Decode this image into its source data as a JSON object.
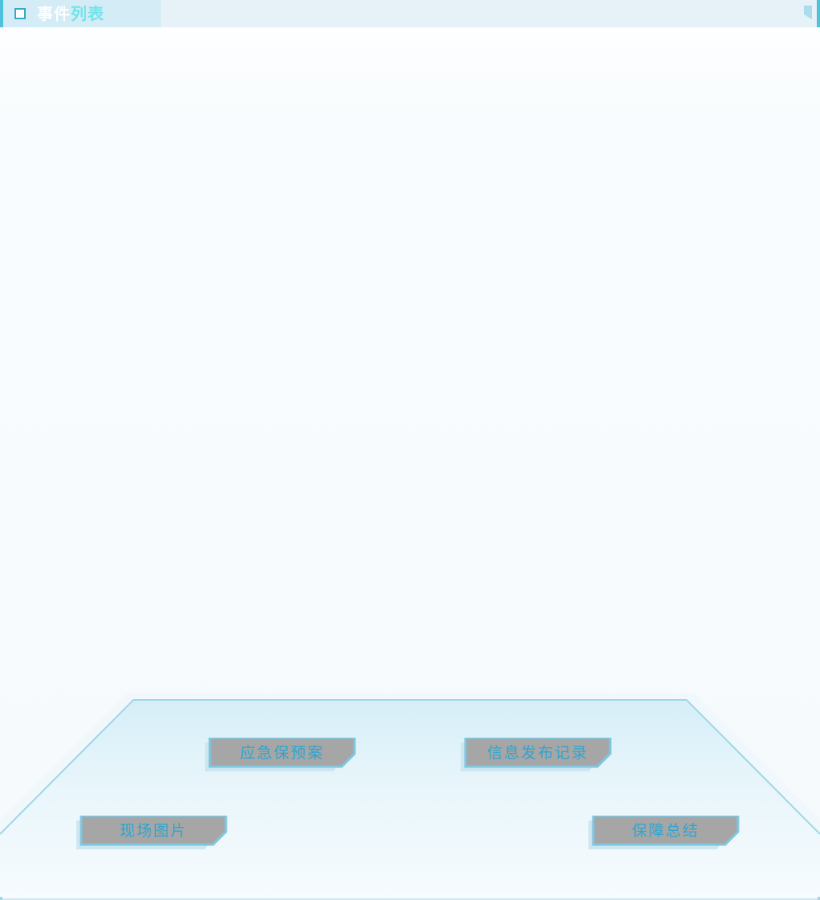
{
  "header": {
    "title_part1": "事件",
    "title_part2": "列表",
    "square_icon": "square-outline-icon",
    "corner_icon": "bookmark-icon"
  },
  "buttons": {
    "emergency_plan": "应急保预案",
    "info_release": "信息发布记录",
    "site_photos": "现场图片",
    "summary": "保障总结"
  },
  "colors": {
    "accent": "#4fc1da",
    "title_highlight": "#6fe4ea",
    "button_fill": "#a6a6a6",
    "button_text": "#2ea5cf"
  }
}
